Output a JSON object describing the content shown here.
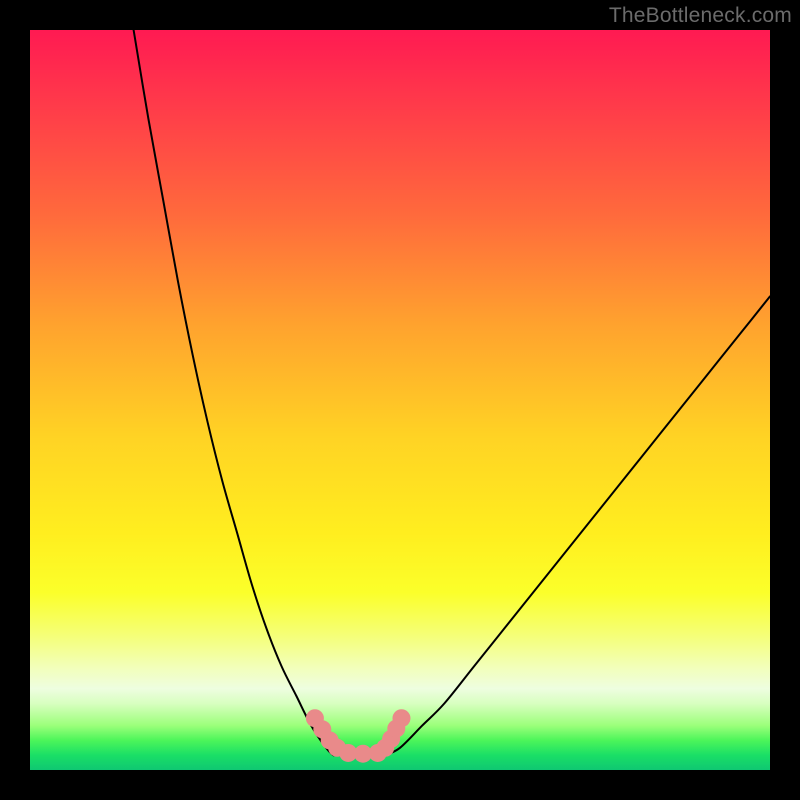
{
  "watermark": "TheBottleneck.com",
  "chart_data": {
    "type": "line",
    "title": "",
    "xlabel": "",
    "ylabel": "",
    "xlim": [
      0,
      100
    ],
    "ylim": [
      0,
      100
    ],
    "series": [
      {
        "name": "left-curve",
        "x": [
          14,
          16,
          18,
          20,
          22,
          24,
          26,
          28,
          30,
          32,
          34,
          36,
          38,
          40,
          41
        ],
        "y": [
          100,
          88,
          77,
          66,
          56,
          47,
          39,
          32,
          25,
          19,
          14,
          10,
          6,
          3,
          2
        ]
      },
      {
        "name": "right-curve",
        "x": [
          48,
          50,
          53,
          56,
          60,
          64,
          68,
          72,
          76,
          80,
          84,
          88,
          92,
          96,
          100
        ],
        "y": [
          2,
          3,
          6,
          9,
          14,
          19,
          24,
          29,
          34,
          39,
          44,
          49,
          54,
          59,
          64
        ]
      },
      {
        "name": "bottom-flat",
        "x": [
          41,
          44,
          46,
          48
        ],
        "y": [
          2,
          2,
          2,
          2
        ]
      }
    ],
    "markers": {
      "name": "pink-markers",
      "color": "#e98a8a",
      "points_x": [
        38.5,
        39.5,
        40.5,
        41.5,
        43,
        45,
        47,
        48,
        48.8,
        49.5,
        50.2
      ],
      "points_y": [
        7,
        5.5,
        4,
        3,
        2.3,
        2.2,
        2.3,
        3,
        4.2,
        5.6,
        7
      ]
    },
    "gradient_stops": [
      {
        "pos": 0,
        "color": "#ff1a52"
      },
      {
        "pos": 25,
        "color": "#ff6a3c"
      },
      {
        "pos": 55,
        "color": "#ffd324"
      },
      {
        "pos": 76,
        "color": "#fbff2a"
      },
      {
        "pos": 89,
        "color": "#eefee0"
      },
      {
        "pos": 100,
        "color": "#0fc772"
      }
    ]
  }
}
